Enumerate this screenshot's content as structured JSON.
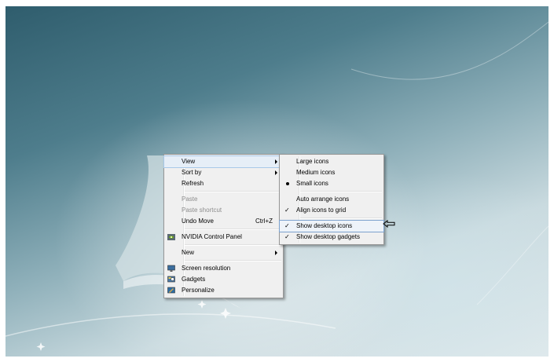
{
  "context_menu": {
    "view": "View",
    "sort_by": "Sort by",
    "refresh": "Refresh",
    "paste": "Paste",
    "paste_shortcut": "Paste shortcut",
    "undo_move": "Undo Move",
    "undo_move_shortcut": "Ctrl+Z",
    "nvidia": "NVIDIA Control Panel",
    "new": "New",
    "screen_resolution": "Screen resolution",
    "gadgets": "Gadgets",
    "personalize": "Personalize"
  },
  "view_submenu": {
    "large_icons": "Large icons",
    "medium_icons": "Medium icons",
    "small_icons": "Small icons",
    "auto_arrange": "Auto arrange icons",
    "align_to_grid": "Align icons to grid",
    "show_desktop_icons": "Show desktop icons",
    "show_desktop_gadgets": "Show desktop gadgets",
    "check_mark": "✓",
    "selected_icon_size": "Small icons",
    "checked_items": [
      "Align icons to grid",
      "Show desktop icons",
      "Show desktop gadgets"
    ]
  },
  "icons": {
    "nvidia": "nvidia-icon",
    "screen_resolution": "monitor-icon",
    "gadgets": "gadgets-icon",
    "personalize": "personalize-icon",
    "annotation": "left-arrow-icon"
  },
  "colors": {
    "menu_background": "#f0f0f0",
    "menu_border": "#979797",
    "highlight": "#e6eef7",
    "disabled_text": "#8d8d8d",
    "nvidia_green": "#76b900"
  }
}
